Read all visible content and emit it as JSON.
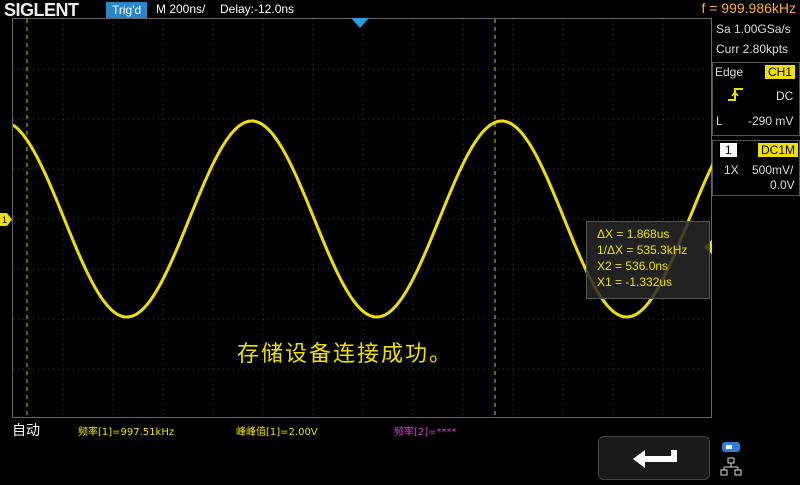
{
  "topbar": {
    "brand": "SIGLENT",
    "trigger_status": "Trig'd",
    "timebase": "M 200ns/",
    "delay": "Delay:-12.0ns",
    "frequency": "f = 999.986kHz"
  },
  "acquisition": {
    "sample_rate": "Sa 1.00GSa/s",
    "memory_depth": "Curr 2.80kpts"
  },
  "trigger": {
    "type": "Edge",
    "source": "CH1",
    "coupling": "DC",
    "level_prefix": "L",
    "level": "-290 mV"
  },
  "channel1": {
    "number": "1",
    "coupling_impedance": "DC1M",
    "probe": "1X",
    "scale": "500mV/",
    "offset": "0.0V",
    "marker_label": "1"
  },
  "cursors": {
    "delta_x": "ΔX = 1.868us",
    "inv_delta_x": "1/ΔX = 535.3kHz",
    "x2": "X2 = 536.0ns",
    "x1": "X1 = -1.332us"
  },
  "message": "存储设备连接成功。",
  "bottom": {
    "acq_mode": "自动",
    "measure1": "频率[1]=997.51kHz",
    "measure2": "峰峰值[1]=2.00V",
    "measure3": "频率[2]=****"
  },
  "colors": {
    "ch1": "#f0e000",
    "trigger_accent": "#2c85c8",
    "frequency_text": "#ffb028",
    "ch2": "#d040d0"
  },
  "icons": {
    "back": "return-arrow-icon",
    "usb": "usb-storage-icon",
    "network": "network-icon"
  }
}
